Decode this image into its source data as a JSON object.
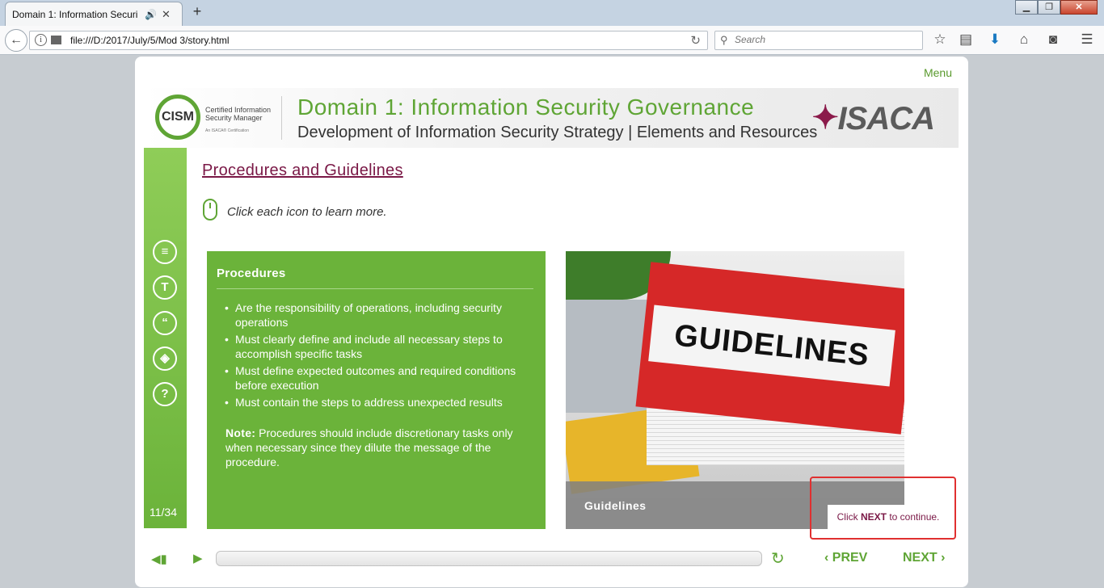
{
  "browser": {
    "tab_title": "Domain 1: Information Securi",
    "url": "file:///D:/2017/July/5/Mod 3/story.html",
    "search_placeholder": "Search",
    "new_tab_label": "+",
    "tab_close_label": "✕"
  },
  "player": {
    "menu_label": "Menu",
    "banner": {
      "logo_text": "CISM",
      "logo_tagline": "Certified Information Security Manager",
      "logo_subtag": "An ISACA® Certification",
      "title": "Domain 1: Information Security Governance",
      "subtitle": "Development of Information Security Strategy | Elements and Resources",
      "brand": "ISACA"
    },
    "slide_count": "11/34",
    "heading": "Procedures and Guidelines",
    "instruction": "Click each icon to learn more.",
    "sidebar_icons": [
      "document-icon",
      "text-icon",
      "quote-icon",
      "layers-icon",
      "help-icon"
    ],
    "procedures": {
      "title": "Procedures",
      "items": [
        "Are the responsibility of operations, including security operations",
        "Must clearly define and include all necessary steps to accomplish specific tasks",
        "Must define expected outcomes and required conditions before execution",
        "Must contain the steps to address unexpected results"
      ],
      "note_label": "Note:",
      "note_text": "Procedures should include discretionary tasks only when necessary since they dilute the message of the procedure."
    },
    "image": {
      "binder_text": "GUIDELINES",
      "caption": "Guidelines"
    },
    "hint": {
      "prefix": "Click",
      "bold": "NEXT",
      "suffix": "to continue."
    },
    "controls": {
      "prev_label": "PREV",
      "next_label": "NEXT"
    }
  },
  "colors": {
    "accent_green": "#6bb33a",
    "heading_maroon": "#7a1846",
    "hint_border": "#e03030"
  }
}
